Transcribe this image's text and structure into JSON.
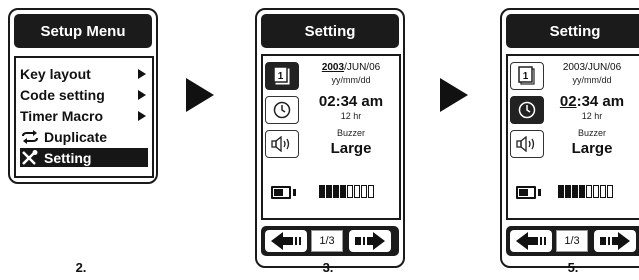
{
  "panels": [
    {
      "title": "Setup Menu",
      "items": [
        {
          "label": "Key layout",
          "icon": "none",
          "arrow": true,
          "selected": false
        },
        {
          "label": "Code setting",
          "icon": "none",
          "arrow": true,
          "selected": false
        },
        {
          "label": "Timer Macro",
          "icon": "none",
          "arrow": true,
          "selected": false
        },
        {
          "label": "Duplicate",
          "icon": "duplicate-arrows-icon",
          "arrow": false,
          "selected": false
        },
        {
          "label": "Setting",
          "icon": "tools-icon",
          "arrow": false,
          "selected": true
        }
      ],
      "caption": "2."
    },
    {
      "title": "Setting",
      "date_year": "2003",
      "date_rest": "/JUN/06",
      "date_format": "yy/mm/dd",
      "time_value": "02:34 am",
      "time_format": "12 hr",
      "buzzer_label": "Buzzer",
      "buzzer_value": "Large",
      "battery_level": 0.5,
      "page_indicator": "1/3",
      "caption": "3."
    },
    {
      "title": "Setting",
      "date_value": "2003/JUN/06",
      "date_format": "yy/mm/dd",
      "time_hour": "02",
      "time_rest": ":34 am",
      "time_format": "12 hr",
      "buzzer_label": "Buzzer",
      "buzzer_value": "Large",
      "battery_level": 0.5,
      "page_indicator": "1/3",
      "caption": "5."
    }
  ],
  "colors": {
    "dark": "#1b1b1b",
    "background": "#ffffff"
  }
}
